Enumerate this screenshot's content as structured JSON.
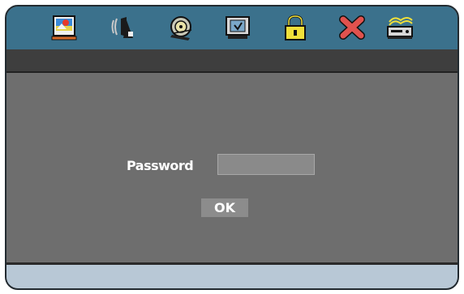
{
  "toolbar": {
    "icons": [
      {
        "name": "picture",
        "icon": "picture-icon"
      },
      {
        "name": "audio",
        "icon": "speaker-icon"
      },
      {
        "name": "video",
        "icon": "film-reel-icon"
      },
      {
        "name": "monitor",
        "icon": "monitor-icon"
      },
      {
        "name": "lock",
        "icon": "lock-icon"
      },
      {
        "name": "close",
        "icon": "close-icon"
      },
      {
        "name": "disc-player",
        "icon": "disc-player-icon"
      }
    ]
  },
  "dialog": {
    "password_label": "Password",
    "password_value": "",
    "ok_label": "OK"
  },
  "colors": {
    "toolbar_bg": "#3b718c",
    "panel_bg": "#6e6e6e",
    "footer_bg": "#b8c8d6"
  }
}
